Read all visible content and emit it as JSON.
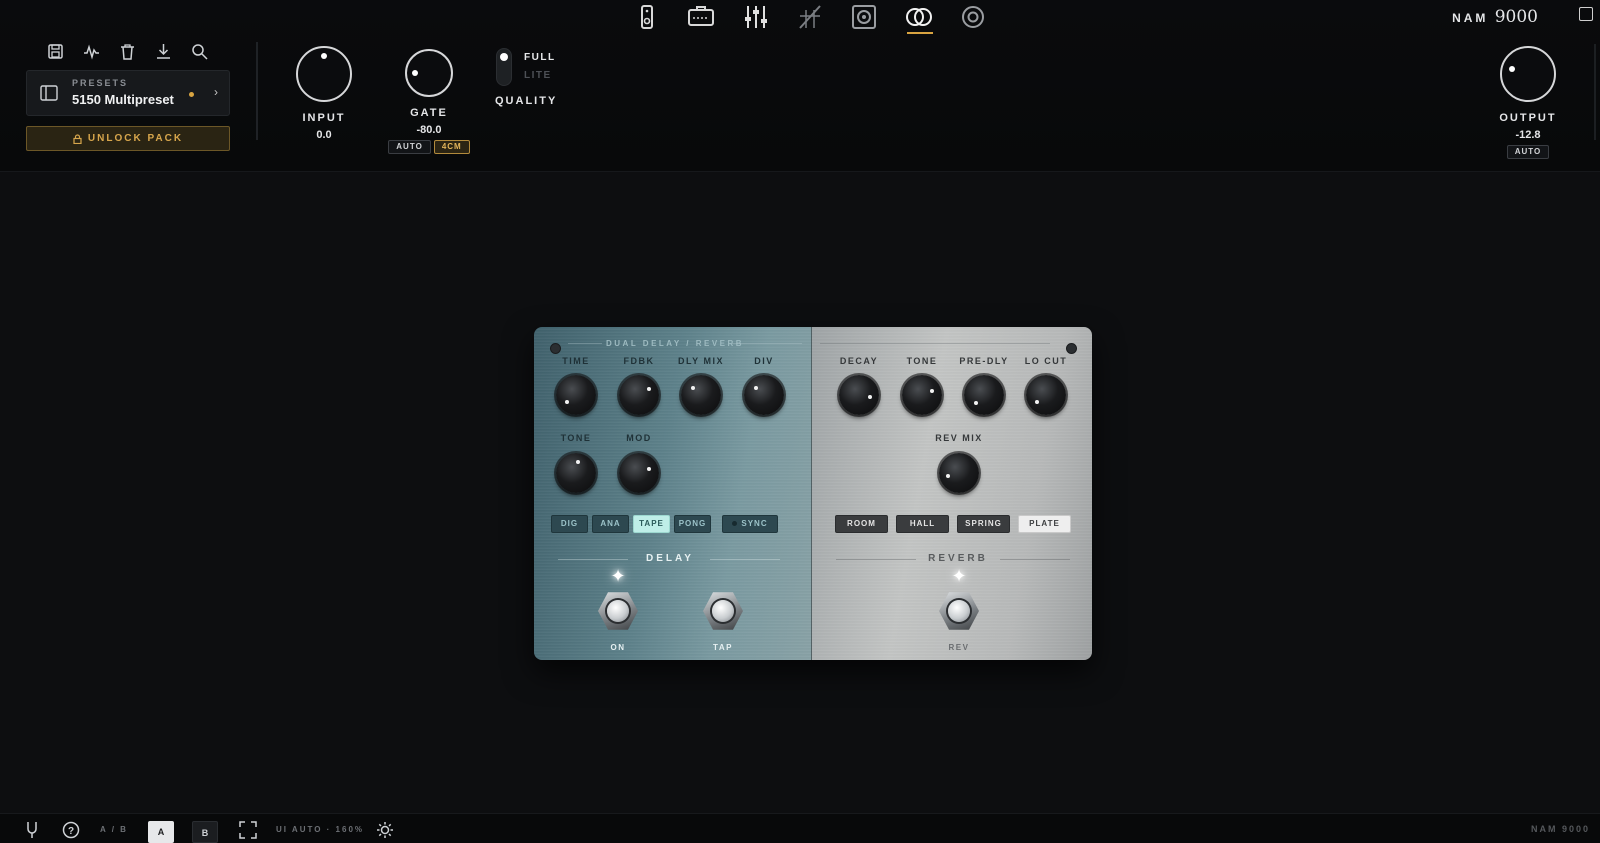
{
  "app": {
    "brand_name": "NAM",
    "brand_number": "9000",
    "footer_brand": "NAM 9000"
  },
  "nav": {
    "tabs": [
      "pedal-icon",
      "amp-icon",
      "eq-sliders-icon",
      "cabinet-ir-icon",
      "speaker-icon",
      "dual-circles-icon",
      "reverb-circle-icon"
    ],
    "active_tab": "dual-circles-icon",
    "accent_color": "#d9a441"
  },
  "presets": {
    "label": "PRESETS",
    "name": "5150 Multipreset",
    "modified": true,
    "unlock_label": "UNLOCK PACK",
    "tools": [
      "save-icon",
      "waveform-icon",
      "trash-icon",
      "download-icon",
      "search-icon"
    ]
  },
  "input": {
    "label": "INPUT",
    "value": "0.0"
  },
  "gate": {
    "label": "GATE",
    "value": "-80.0",
    "auto_label": "AUTO",
    "mode_label": "4CM"
  },
  "quality": {
    "label": "QUALITY",
    "full_label": "FULL",
    "lite_label": "LITE",
    "selected": "FULL"
  },
  "output": {
    "label": "OUTPUT",
    "value": "-12.8",
    "auto_label": "AUTO"
  },
  "pedal": {
    "title": "DUAL DELAY / REVERB",
    "delay": {
      "section_label": "DELAY",
      "knob_labels": {
        "time": "TIME",
        "fdbk": "FDBK",
        "dly_mix": "DLY MIX",
        "div": "DIV",
        "tone": "TONE",
        "mod": "MOD"
      },
      "modes": [
        "DIG",
        "ANA",
        "TAPE",
        "PONG"
      ],
      "active_mode": "TAPE",
      "sync_label": "SYNC",
      "on_label": "ON",
      "tap_label": "TAP",
      "led_color": "#ffffff"
    },
    "reverb": {
      "section_label": "REVERB",
      "knob_labels": {
        "decay": "DECAY",
        "tone": "TONE",
        "pre_dly": "PRE-DLY",
        "lo_cut": "LO CUT",
        "rev_mix": "REV MIX"
      },
      "modes": [
        "ROOM",
        "HALL",
        "SPRING",
        "PLATE"
      ],
      "active_mode": "PLATE",
      "rev_label": "REV"
    }
  },
  "bottom": {
    "ab_label": "A / B",
    "a_label": "A",
    "b_label": "B",
    "ui_scale_label": "UI AUTO · 160%"
  }
}
